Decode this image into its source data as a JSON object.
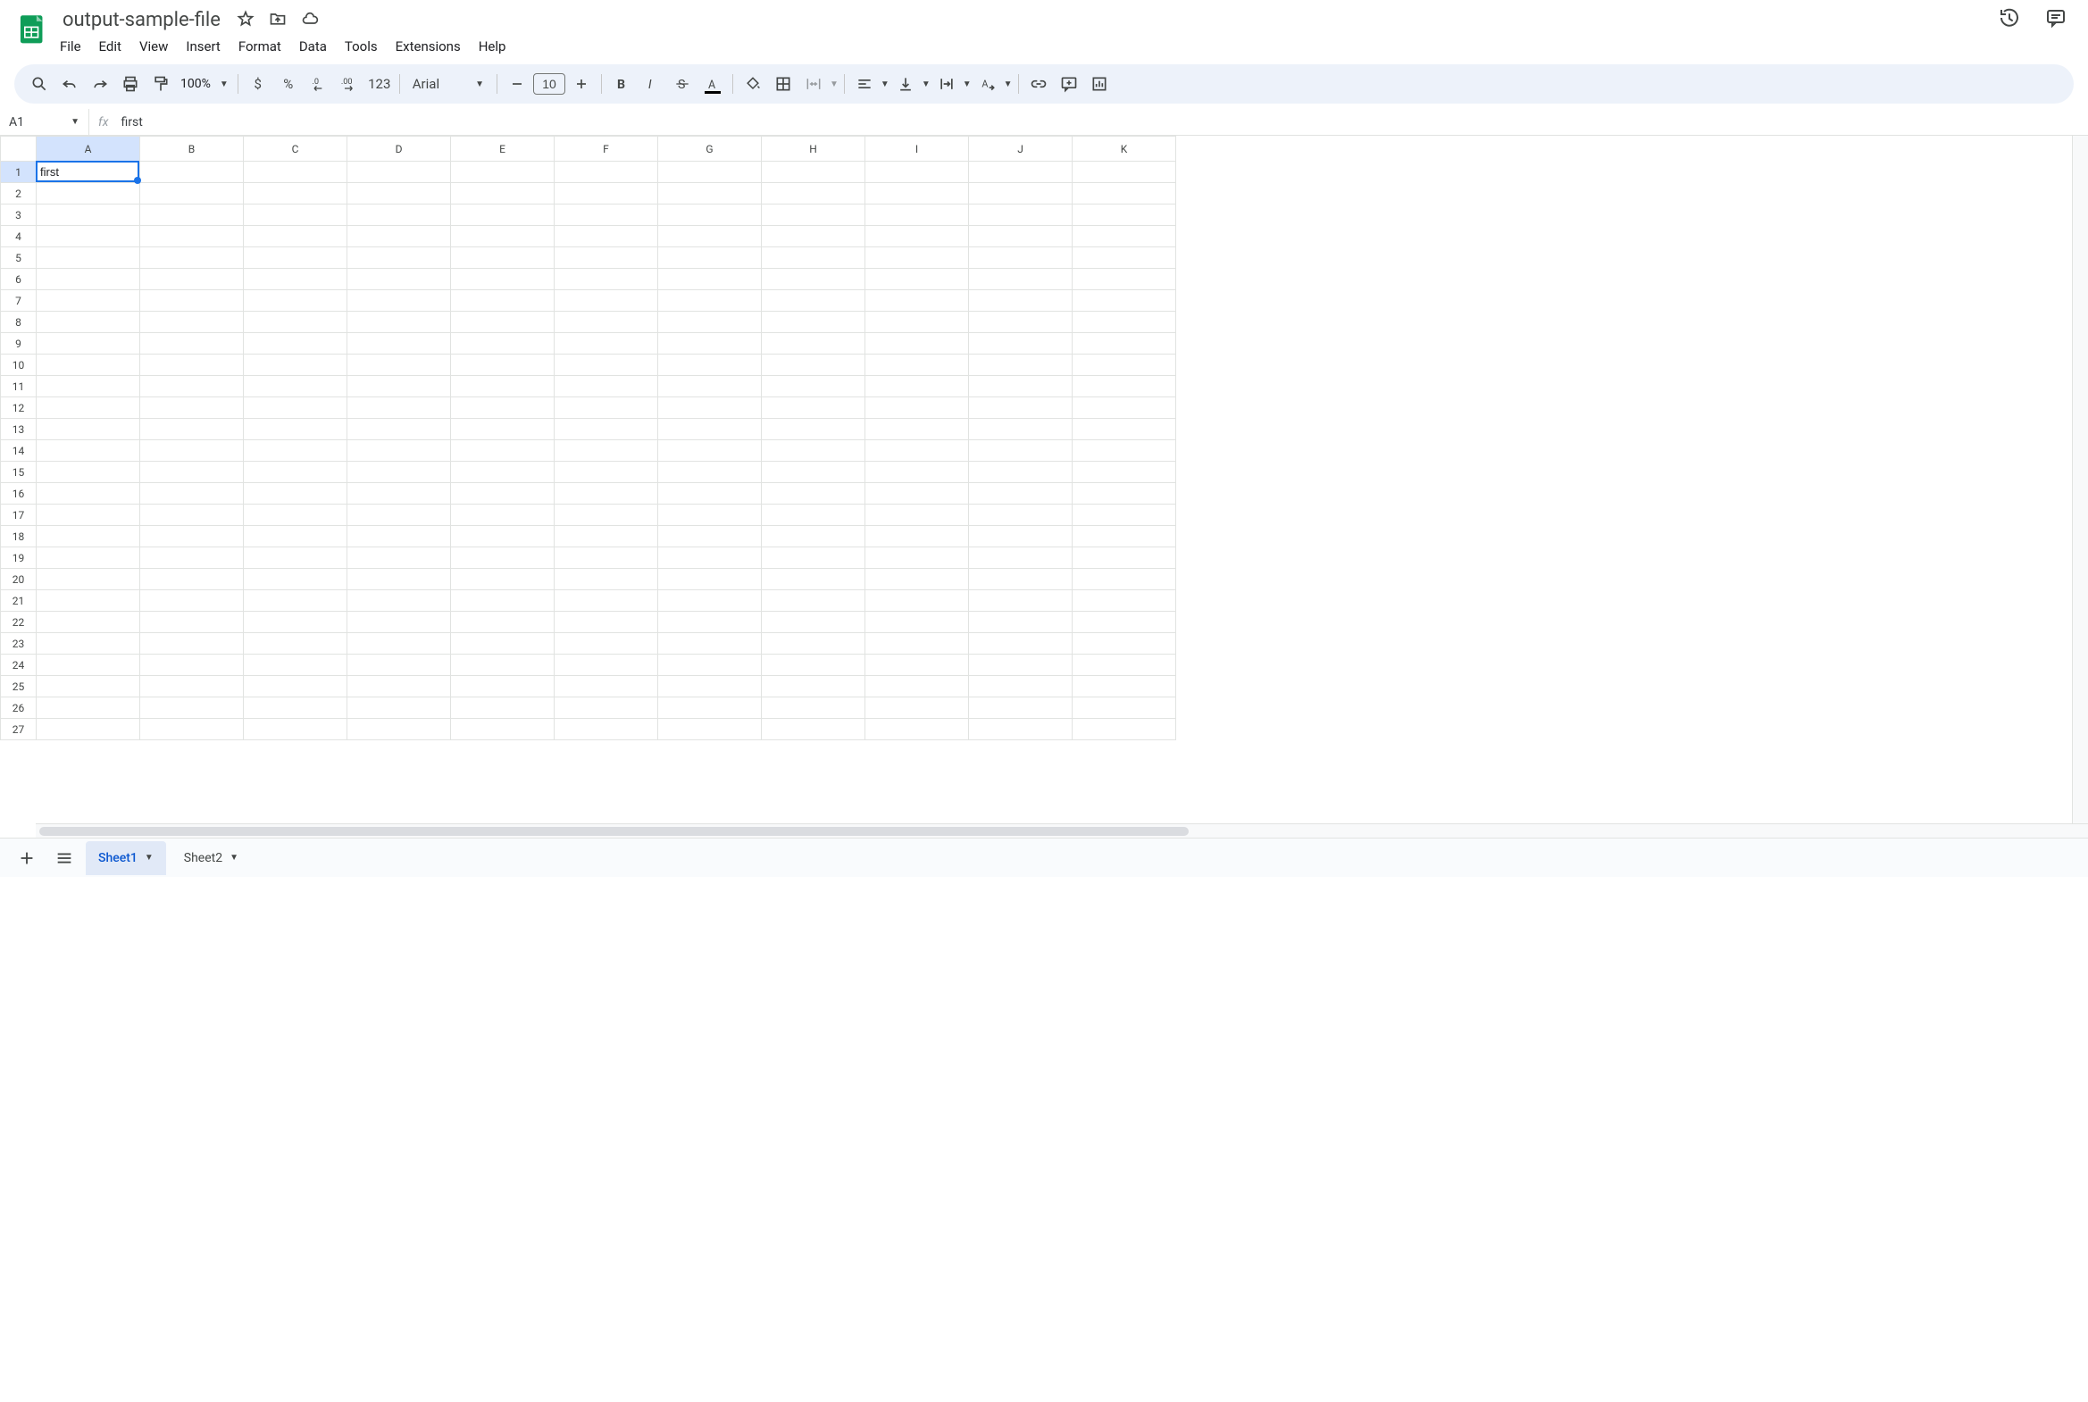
{
  "doc": {
    "title": "output-sample-file"
  },
  "menu": {
    "file": "File",
    "edit": "Edit",
    "view": "View",
    "insert": "Insert",
    "format": "Format",
    "data": "Data",
    "tools": "Tools",
    "extensions": "Extensions",
    "help": "Help"
  },
  "toolbar": {
    "zoom": "100%",
    "currency": "$",
    "percent": "%",
    "decdec": ".0",
    "incdec": ".00",
    "numfmt": "123",
    "font": "Arial",
    "size": "10"
  },
  "namebox": {
    "ref": "A1"
  },
  "formula": {
    "label": "fx",
    "value": "first"
  },
  "columns": [
    "A",
    "B",
    "C",
    "D",
    "E",
    "F",
    "G",
    "H",
    "I",
    "J",
    "K"
  ],
  "rows": [
    "1",
    "2",
    "3",
    "4",
    "5",
    "6",
    "7",
    "8",
    "9",
    "10",
    "11",
    "12",
    "13",
    "14",
    "15",
    "16",
    "17",
    "18",
    "19",
    "20",
    "21",
    "22",
    "23",
    "24",
    "25",
    "26",
    "27"
  ],
  "cells": {
    "A1": "first"
  },
  "selection": {
    "col": "A",
    "row": "1"
  },
  "sheets": {
    "sheet1": "Sheet1",
    "sheet2": "Sheet2"
  }
}
